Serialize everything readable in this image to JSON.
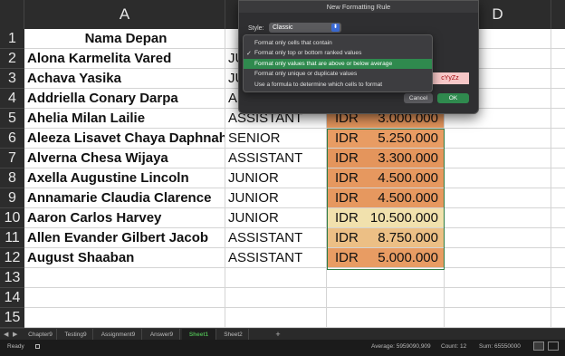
{
  "columns": [
    "A",
    "",
    "",
    "D",
    ""
  ],
  "rows": [
    {
      "num": "1",
      "name": "Nama Depan",
      "level": "",
      "currency": "",
      "amount": "",
      "fill": "#ffffff"
    },
    {
      "num": "2",
      "name": "Alona Karmelita Vared",
      "level": "JUN",
      "currency": "",
      "amount": "",
      "fill": "#ffffff"
    },
    {
      "num": "3",
      "name": "Achava Yasika",
      "level": "JUN",
      "currency": "",
      "amount": "",
      "fill": "#ffffff"
    },
    {
      "num": "4",
      "name": "Addriella Conary Darpa",
      "level": "A",
      "currency": "",
      "amount": "",
      "fill": "#ffffff"
    },
    {
      "num": "5",
      "name": "Ahelia Milan Lailie",
      "level": "ASSISTANT",
      "currency": "IDR",
      "amount": "3.000.000",
      "fill": "#e4955c"
    },
    {
      "num": "6",
      "name": "Aleeza Lisavet Chaya Daphnah",
      "level": "SENIOR",
      "currency": "IDR",
      "amount": "5.250.000",
      "fill": "#e89c63"
    },
    {
      "num": "7",
      "name": "Alverna Chesa Wijaya",
      "level": "ASSISTANT",
      "currency": "IDR",
      "amount": "3.300.000",
      "fill": "#e4955c"
    },
    {
      "num": "8",
      "name": "Axella Augustine Lincoln",
      "level": "JUNIOR",
      "currency": "IDR",
      "amount": "4.500.000",
      "fill": "#e6985f"
    },
    {
      "num": "9",
      "name": "Annamarie Claudia Clarence",
      "level": "JUNIOR",
      "currency": "IDR",
      "amount": "4.500.000",
      "fill": "#e6985f"
    },
    {
      "num": "10",
      "name": "Aaron Carlos Harvey",
      "level": "JUNIOR",
      "currency": "IDR",
      "amount": "10.500.000",
      "fill": "#f1e1ad"
    },
    {
      "num": "11",
      "name": "Allen Evander Gilbert Jacob",
      "level": "ASSISTANT",
      "currency": "IDR",
      "amount": "8.750.000",
      "fill": "#ecbf85"
    },
    {
      "num": "12",
      "name": "August Shaaban",
      "level": "ASSISTANT",
      "currency": "IDR",
      "amount": "5.000.000",
      "fill": "#e89c63"
    },
    {
      "num": "13",
      "name": "",
      "level": "",
      "currency": "",
      "amount": "",
      "fill": "#ffffff"
    },
    {
      "num": "14",
      "name": "",
      "level": "",
      "currency": "",
      "amount": "",
      "fill": "#ffffff"
    },
    {
      "num": "15",
      "name": "",
      "level": "",
      "currency": "",
      "amount": "",
      "fill": "#ffffff"
    }
  ],
  "dialog": {
    "title": "New Formatting Rule",
    "style_label": "Style:",
    "style_value": "Classic",
    "menu_items": [
      {
        "label": "Format only cells that contain",
        "checked": false,
        "highlighted": false
      },
      {
        "label": "Format only top or bottom ranked values",
        "checked": true,
        "highlighted": false
      },
      {
        "label": "Format only values that are above or below average",
        "checked": false,
        "highlighted": true
      },
      {
        "label": "Format only unique or duplicate values",
        "checked": false,
        "highlighted": false
      },
      {
        "label": "Use a formula to determine which cells to format",
        "checked": false,
        "highlighted": false
      }
    ],
    "preview_text": "cYyZz",
    "cancel_label": "Cancel",
    "ok_label": "OK"
  },
  "tabs": [
    {
      "label": "Chapter9",
      "active": false
    },
    {
      "label": "Testing9",
      "active": false
    },
    {
      "label": "Assignment9",
      "active": false
    },
    {
      "label": "Answer9",
      "active": false
    },
    {
      "label": "Sheet1",
      "active": true
    },
    {
      "label": "Sheet2",
      "active": false
    }
  ],
  "add_sheet_label": "+",
  "status": {
    "ready": "Ready",
    "average": "Average: 5959090,909",
    "count": "Count: 12",
    "sum": "Sum: 65550000"
  },
  "colors": {
    "accent": "#2f8a4e",
    "heat_low": "#e4955c",
    "heat_high": "#f1e1ad"
  }
}
